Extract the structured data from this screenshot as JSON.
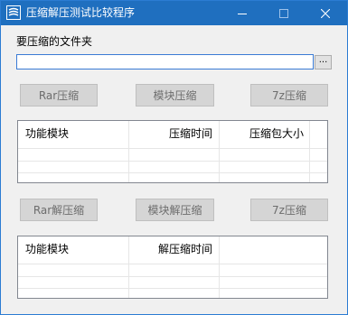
{
  "window": {
    "title": "压缩解压测试比较程序",
    "min_glyph": "—",
    "max_glyph": "☐",
    "close_glyph": "✕"
  },
  "folder": {
    "label": "要压缩的文件夹",
    "value": "",
    "browse_label": "..."
  },
  "compress_buttons": {
    "rar": "Rar压缩",
    "module": "模块压缩",
    "sevenz": "7z压缩"
  },
  "compress_table": {
    "columns": [
      "功能模块",
      "压缩时间",
      "压缩包大小"
    ]
  },
  "decompress_buttons": {
    "rar": "Rar解压缩",
    "module": "模块解压缩",
    "sevenz": "7z压缩"
  },
  "decompress_table": {
    "columns": [
      "功能模块",
      "解压缩时间"
    ]
  },
  "colors": {
    "titlebar": "#1f6fbf",
    "disabled_button": "#d5d5d5",
    "disabled_text": "#6d6d6d"
  }
}
